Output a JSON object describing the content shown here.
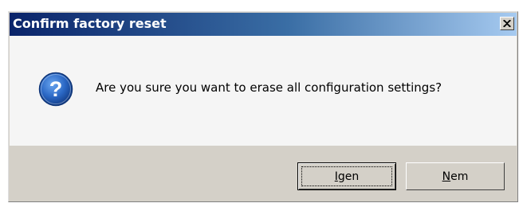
{
  "dialog": {
    "title": "Confirm factory reset",
    "icon": "question-icon",
    "message": "Are you sure you want to erase all configuration settings?"
  },
  "buttons": {
    "yes": {
      "mnemonic": "I",
      "rest": "gen"
    },
    "no": {
      "mnemonic": "N",
      "rest": "em"
    }
  },
  "colors": {
    "title_gradient_start": "#0a246a",
    "title_gradient_end": "#a6caf0",
    "icon_blue": "#1f5fb8"
  }
}
